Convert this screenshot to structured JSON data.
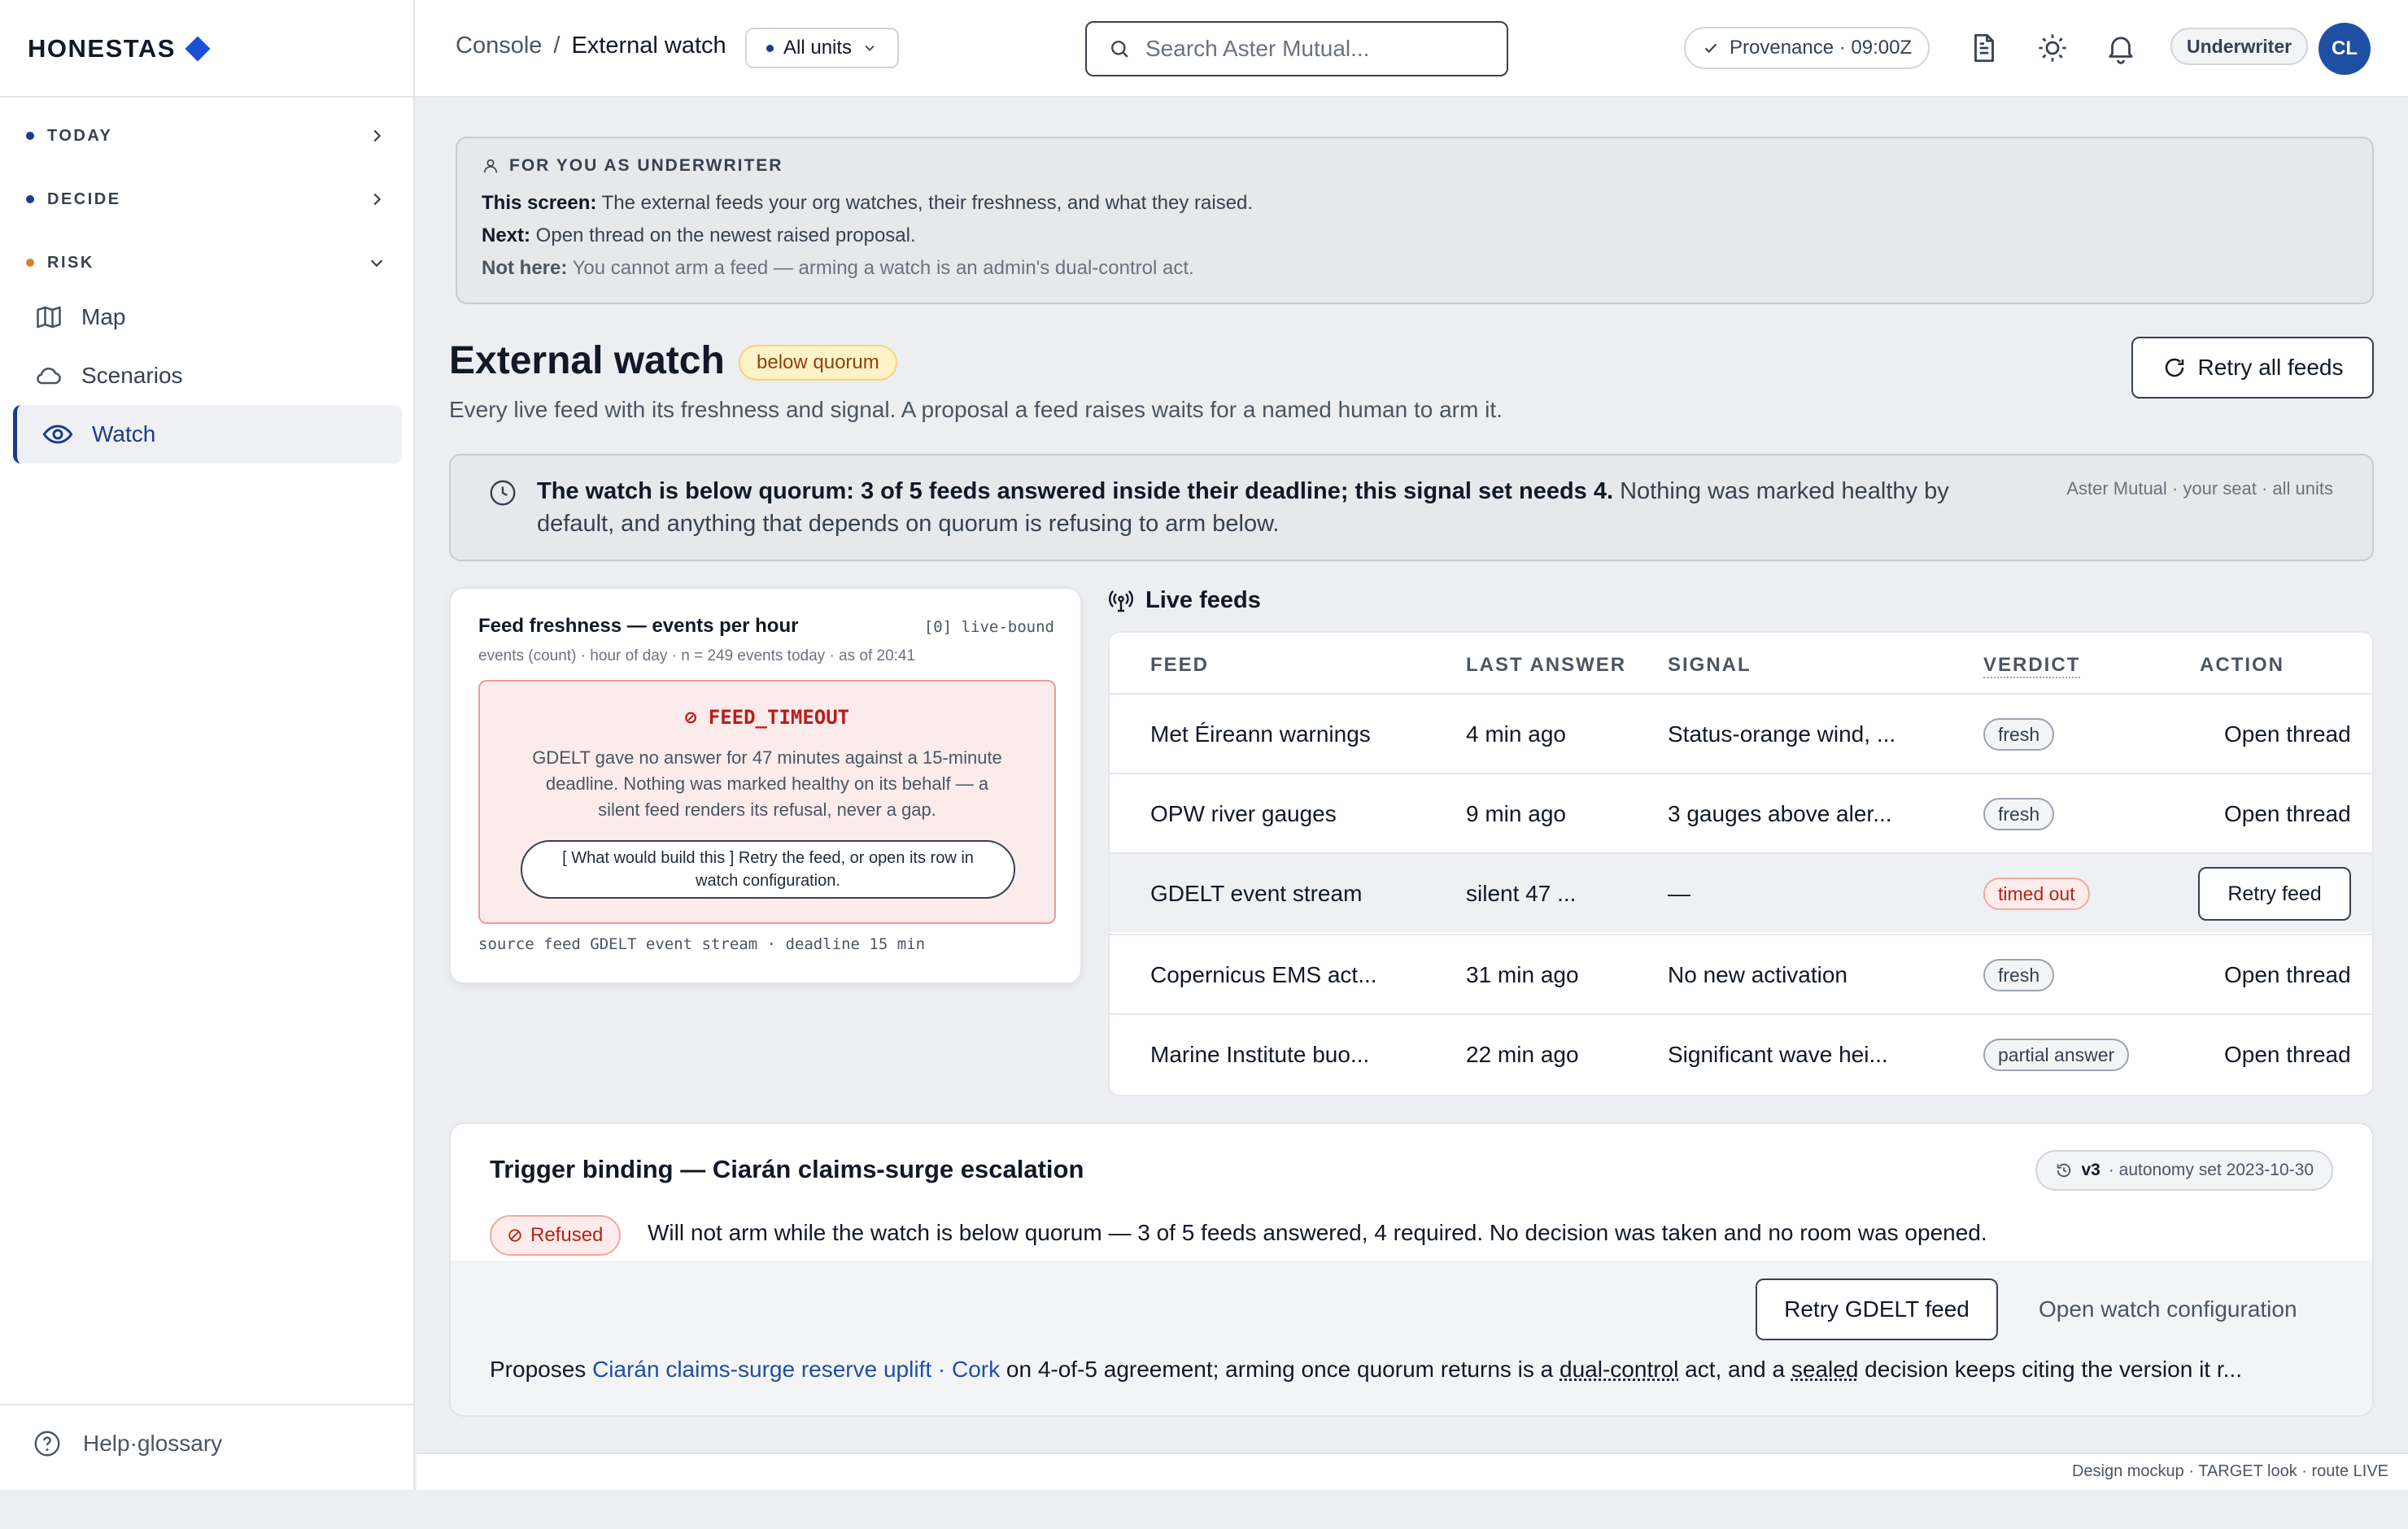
{
  "brand": {
    "name": "HONESTAS",
    "accent": "#1d4ed8"
  },
  "sidebar": {
    "sections": [
      {
        "label": "TODAY",
        "dot_color": "#1e3a8a"
      },
      {
        "label": "DECIDE",
        "dot_color": "#1e3a8a"
      },
      {
        "label": "RISK",
        "dot_color": "#d9822b"
      }
    ],
    "items": [
      {
        "label": "Map",
        "icon": "map-icon"
      },
      {
        "label": "Scenarios",
        "icon": "cloud-icon"
      },
      {
        "label": "Watch",
        "icon": "eye-icon",
        "active": true
      }
    ],
    "help": "Help·glossary"
  },
  "topbar": {
    "crumb_root": "Console",
    "crumb_sep": "/",
    "crumb_current": "External watch",
    "units": "All units",
    "search_placeholder": "Search Aster Mutual...",
    "provenance": "Provenance · 09:00Z",
    "role": "Underwriter",
    "avatar": "CL"
  },
  "info": {
    "heading": "FOR YOU AS UNDERWRITER",
    "this_label": "This screen:",
    "this_text": " The external feeds your org watches, their freshness, and what they raised.",
    "next_label": "Next:",
    "next_text": " Open thread on the newest raised proposal.",
    "not_label": "Not here:",
    "not_text": " You cannot arm a feed — arming a watch is an admin's dual-control act."
  },
  "page": {
    "title": "External watch",
    "badge": "below quorum",
    "subtitle": "Every live feed with its freshness and signal. A proposal a feed raises waits for a named human to arm it.",
    "retry_all": "Retry all feeds"
  },
  "banner": {
    "bold": "The watch is below quorum: 3 of 5 feeds answered inside their deadline; this signal set needs 4.",
    "rest": " Nothing was marked healthy by default, and anything that depends on quorum is refusing to arm below.",
    "meta": "Aster Mutual · your seat · all units"
  },
  "freshness": {
    "title": "Feed freshness — events per hour",
    "tag": "[0] live-bound",
    "subtitle": "events (count) · hour of day · n = 249 events today · as of 20:41",
    "error_code": "⊘ FEED_TIMEOUT",
    "error_msg": "GDELT gave no answer for 47 minutes against a 15-minute deadline. Nothing was marked healthy on its behalf — a silent feed renders its refusal, never a gap.",
    "hint": "[ What would build this ] Retry the feed, or open its row in watch configuration.",
    "footer": "source feed GDELT event stream · deadline 15 min"
  },
  "feeds": {
    "heading": "Live feeds",
    "columns": [
      "FEED",
      "LAST ANSWER",
      "SIGNAL",
      "VERDICT",
      "ACTION"
    ],
    "rows": [
      {
        "feed": "Met Éireann warnings",
        "last": "4 min ago",
        "signal": "Status-orange wind, ...",
        "verdict": "fresh",
        "action": "Open thread"
      },
      {
        "feed": "OPW river gauges",
        "last": "9 min ago",
        "signal": "3 gauges above aler...",
        "verdict": "fresh",
        "action": "Open thread"
      },
      {
        "feed": "GDELT event stream",
        "last": "silent 47 ...",
        "signal": "—",
        "verdict": "timed out",
        "action": "Retry feed"
      },
      {
        "feed": "Copernicus EMS act...",
        "last": "31 min ago",
        "signal": "No new activation",
        "verdict": "fresh",
        "action": "Open thread"
      },
      {
        "feed": "Marine Institute buo...",
        "last": "22 min ago",
        "signal": "Significant wave hei...",
        "verdict": "partial answer",
        "action": "Open thread"
      }
    ]
  },
  "trigger": {
    "title": "Trigger binding — Ciarán claims-surge escalation",
    "version": "v3",
    "version_meta": "· autonomy set 2023-10-30",
    "status": "Refused",
    "status_text": "Will not arm while the watch is below quorum — 3 of 5 feeds answered, 4 required. No decision was taken and no room was opened.",
    "retry_btn": "Retry GDELT feed",
    "config_link": "Open watch configuration",
    "prop_lead": "Proposes ",
    "prop_link": "Ciarán claims-surge reserve uplift · Cork",
    "prop_mid": " on 4-of-5 agreement; arming once quorum returns is a ",
    "prop_term1": "dual-control",
    "prop_mid2": " act, and a ",
    "prop_term2": "sealed",
    "prop_tail": " decision keeps citing the version it r..."
  },
  "footer": "Design mockup · TARGET look · route LIVE"
}
